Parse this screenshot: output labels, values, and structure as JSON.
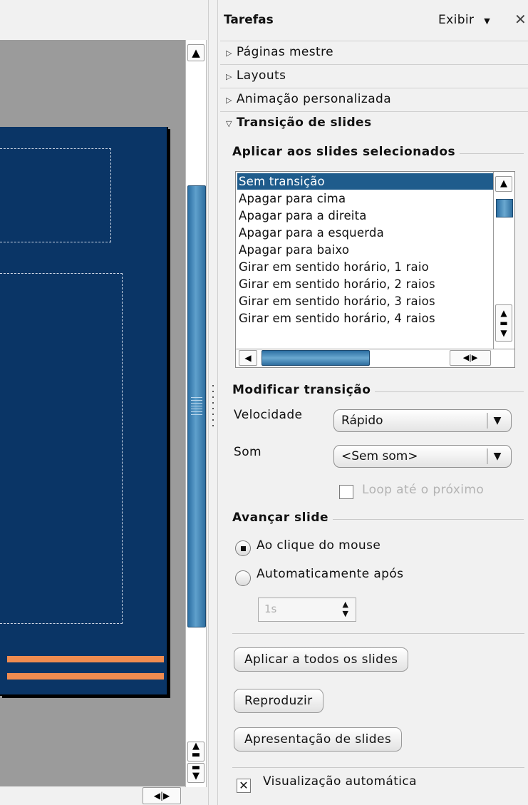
{
  "task_pane": {
    "title": "Tarefas",
    "view_menu": "Exibir",
    "sections": [
      {
        "label": "Páginas mestre",
        "expanded": false
      },
      {
        "label": "Layouts",
        "expanded": false
      },
      {
        "label": "Animação personalizada",
        "expanded": false
      },
      {
        "label": "Transição de slides",
        "expanded": true
      }
    ]
  },
  "transition": {
    "apply_group": "Aplicar aos slides selecionados",
    "list_items": [
      "Sem transição",
      "Apagar para cima",
      "Apagar para a direita",
      "Apagar para a esquerda",
      "Apagar para baixo",
      "Girar em sentido horário, 1 raio",
      "Girar em sentido horário, 2 raios",
      "Girar em sentido horário, 3 raios",
      "Girar em sentido horário, 4 raios"
    ],
    "selected_index": 0,
    "modify_group": "Modificar transição",
    "speed_label": "Velocidade",
    "speed_value": "Rápido",
    "sound_label": "Som",
    "sound_value": "<Sem som>",
    "loop_label": "Loop até o próximo",
    "advance_group": "Avançar slide",
    "on_click_label": "Ao clique do mouse",
    "auto_label": "Automaticamente após",
    "auto_value": "1s",
    "apply_all_button": "Aplicar a todos os slides",
    "play_button": "Reproduzir",
    "slideshow_button": "Apresentação de slides",
    "autopreview_label": "Visualização automática"
  },
  "colors": {
    "slide_background": "#0a3566",
    "stripe": "#f08c50",
    "selection": "#1f5c8c"
  }
}
